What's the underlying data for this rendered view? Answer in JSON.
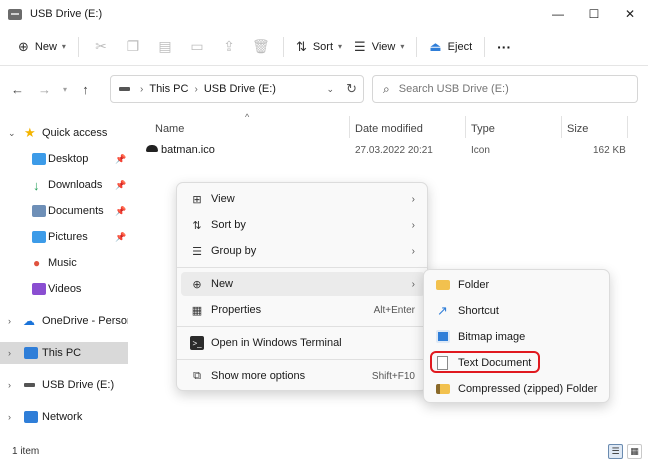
{
  "window": {
    "title": "USB Drive (E:)",
    "minimize": "—",
    "maximize": "☐",
    "close": "✕"
  },
  "commandbar": {
    "new_label": "New",
    "sort_label": "Sort",
    "view_label": "View",
    "eject_label": "Eject",
    "more": "···"
  },
  "address": {
    "crumbs": [
      "This PC",
      "USB Drive (E:)"
    ],
    "search_placeholder": "Search USB Drive (E:)"
  },
  "sidebar": {
    "items": [
      {
        "label": "Quick access",
        "icon": "star-icon",
        "color": "#f4b400"
      },
      {
        "label": "Desktop",
        "icon": "desktop-icon",
        "color": "#3c9be8"
      },
      {
        "label": "Downloads",
        "icon": "download-icon",
        "color": "#1f9d55"
      },
      {
        "label": "Documents",
        "icon": "documents-icon",
        "color": "#6e8fb7"
      },
      {
        "label": "Pictures",
        "icon": "pictures-icon",
        "color": "#3c9be8"
      },
      {
        "label": "Music",
        "icon": "music-icon",
        "color": "#e0533f"
      },
      {
        "label": "Videos",
        "icon": "videos-icon",
        "color": "#8a4ed1"
      },
      {
        "label": "OneDrive - Personal",
        "icon": "cloud-icon",
        "color": "#1a73d9"
      },
      {
        "label": "This PC",
        "icon": "pc-icon",
        "color": "#2f7ed8"
      },
      {
        "label": "USB Drive (E:)",
        "icon": "usb-drive-icon",
        "color": "#555555"
      },
      {
        "label": "Network",
        "icon": "network-icon",
        "color": "#2f7ed8"
      }
    ]
  },
  "columns": {
    "name": "Name",
    "date": "Date modified",
    "type": "Type",
    "size": "Size"
  },
  "files": [
    {
      "name": "batman.ico",
      "date": "27.03.2022 20:21",
      "type": "Icon",
      "size": "162 KB"
    }
  ],
  "context_menu": {
    "items": [
      {
        "label": "View",
        "icon": "view-icon"
      },
      {
        "label": "Sort by",
        "icon": "sort-icon"
      },
      {
        "label": "Group by",
        "icon": "group-icon"
      },
      {
        "label": "New",
        "icon": "add-icon"
      },
      {
        "label": "Properties",
        "icon": "properties-icon",
        "shortcut": "Alt+Enter"
      },
      {
        "label": "Open in Windows Terminal",
        "icon": "terminal-icon"
      },
      {
        "label": "Show more options",
        "icon": "more-options-icon",
        "shortcut": "Shift+F10"
      }
    ]
  },
  "new_submenu": {
    "items": [
      {
        "label": "Folder",
        "icon": "folder-icon"
      },
      {
        "label": "Shortcut",
        "icon": "shortcut-icon"
      },
      {
        "label": "Bitmap image",
        "icon": "bitmap-icon"
      },
      {
        "label": "Text Document",
        "icon": "text-document-icon"
      },
      {
        "label": "Compressed (zipped) Folder",
        "icon": "zip-folder-icon"
      }
    ]
  },
  "status": {
    "count": "1 item"
  },
  "colors": {
    "accent": "#2f7ed8",
    "highlight": "#e0191f",
    "folder": "#f2c14e"
  }
}
